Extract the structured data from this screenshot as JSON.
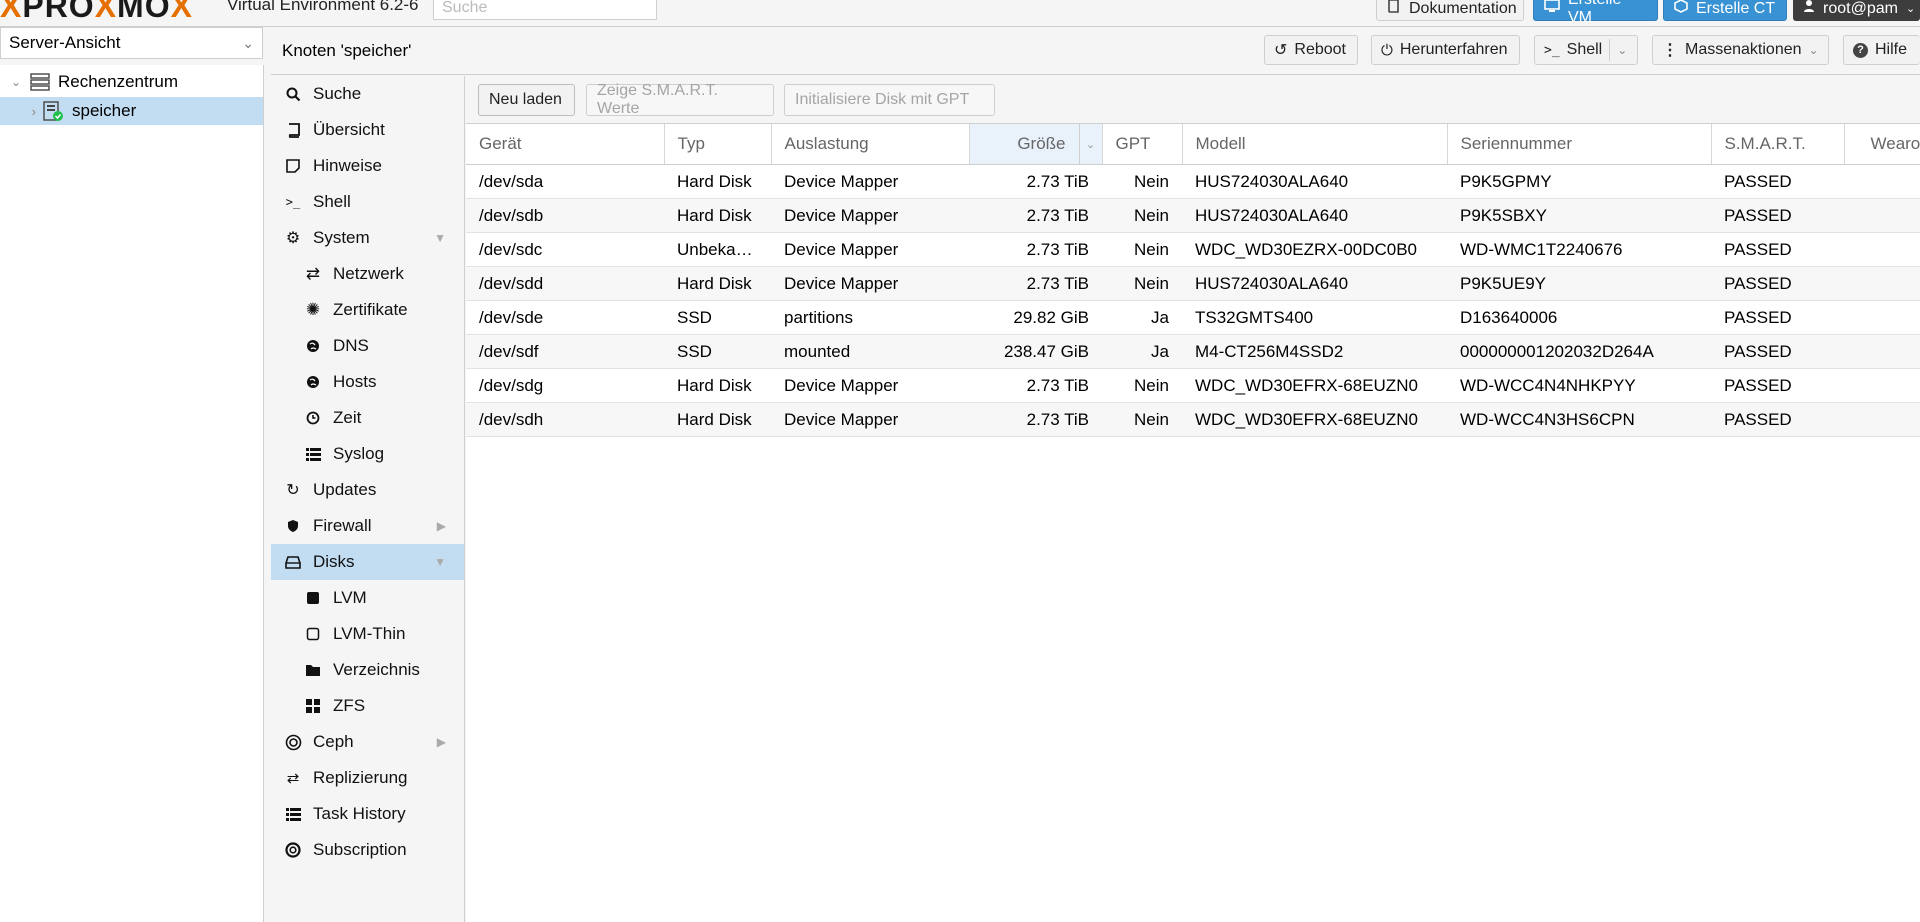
{
  "topbar": {
    "logo_x": "X",
    "logo_text_a": "PRO",
    "logo_mid": "X",
    "logo_text_b": "MO",
    "logo_end": "X",
    "version": "Virtual Environment 6.2-6",
    "search_placeholder": "Suche",
    "doc_button": "Dokumentation",
    "create_vm_button": "Erstelle VM",
    "create_ct_button": "Erstelle CT",
    "user_button": "root@pam"
  },
  "view_selector": {
    "value": "Server-Ansicht"
  },
  "tree": {
    "datacenter": "Rechenzentrum",
    "node": "speicher"
  },
  "node_header": {
    "title": "Knoten 'speicher'",
    "reboot": "Reboot",
    "shutdown": "Herunterfahren",
    "shell": "Shell",
    "bulk": "Massenaktionen",
    "help": "Hilfe"
  },
  "menu": {
    "items": [
      {
        "label": "Suche",
        "icon": "search-icon"
      },
      {
        "label": "Übersicht",
        "icon": "book-icon"
      },
      {
        "label": "Hinweise",
        "icon": "note-icon"
      },
      {
        "label": "Shell",
        "icon": "terminal-icon"
      },
      {
        "label": "System",
        "icon": "gears-icon"
      },
      {
        "label": "Netzwerk",
        "icon": "exchange-icon"
      },
      {
        "label": "Zertifikate",
        "icon": "certificate-icon"
      },
      {
        "label": "DNS",
        "icon": "globe-icon"
      },
      {
        "label": "Hosts",
        "icon": "globe-icon"
      },
      {
        "label": "Zeit",
        "icon": "clock-icon"
      },
      {
        "label": "Syslog",
        "icon": "list-icon"
      },
      {
        "label": "Updates",
        "icon": "refresh-icon"
      },
      {
        "label": "Firewall",
        "icon": "shield-icon"
      },
      {
        "label": "Disks",
        "icon": "hdd-icon"
      },
      {
        "label": "LVM",
        "icon": "square-icon"
      },
      {
        "label": "LVM-Thin",
        "icon": "square-outline-icon"
      },
      {
        "label": "Verzeichnis",
        "icon": "folder-icon"
      },
      {
        "label": "ZFS",
        "icon": "th-large-icon"
      },
      {
        "label": "Ceph",
        "icon": "ceph-icon"
      },
      {
        "label": "Replizierung",
        "icon": "retweet-icon"
      },
      {
        "label": "Task History",
        "icon": "list-icon"
      },
      {
        "label": "Subscription",
        "icon": "support-icon"
      }
    ]
  },
  "toolbar": {
    "reload": "Neu laden",
    "show_smart": "Zeige S.M.A.R.T. Werte",
    "init_gpt": "Initialisiere Disk mit GPT"
  },
  "grid": {
    "columns": [
      "Gerät",
      "Typ",
      "Auslastung",
      "Größe",
      "GPT",
      "Modell",
      "Seriennummer",
      "S.M.A.R.T.",
      "Wearout"
    ],
    "rows": [
      [
        "/dev/sda",
        "Hard Disk",
        "Device Mapper",
        "2.73 TiB",
        "Nein",
        "HUS724030ALA640",
        "P9K5GPMY",
        "PASSED",
        ""
      ],
      [
        "/dev/sdb",
        "Hard Disk",
        "Device Mapper",
        "2.73 TiB",
        "Nein",
        "HUS724030ALA640",
        "P9K5SBXY",
        "PASSED",
        ""
      ],
      [
        "/dev/sdc",
        "Unbeka…",
        "Device Mapper",
        "2.73 TiB",
        "Nein",
        "WDC_WD30EZRX-00DC0B0",
        "WD-WMC1T2240676",
        "PASSED",
        ""
      ],
      [
        "/dev/sdd",
        "Hard Disk",
        "Device Mapper",
        "2.73 TiB",
        "Nein",
        "HUS724030ALA640",
        "P9K5UE9Y",
        "PASSED",
        ""
      ],
      [
        "/dev/sde",
        "SSD",
        "partitions",
        "29.82 GiB",
        "Ja",
        "TS32GMTS400",
        "D163640006",
        "PASSED",
        ""
      ],
      [
        "/dev/sdf",
        "SSD",
        "mounted",
        "238.47 GiB",
        "Ja",
        "M4-CT256M4SSD2",
        "000000001202032D264A",
        "PASSED",
        ""
      ],
      [
        "/dev/sdg",
        "Hard Disk",
        "Device Mapper",
        "2.73 TiB",
        "Nein",
        "WDC_WD30EFRX-68EUZN0",
        "WD-WCC4N4NHKPYY",
        "PASSED",
        ""
      ],
      [
        "/dev/sdh",
        "Hard Disk",
        "Device Mapper",
        "2.73 TiB",
        "Nein",
        "WDC_WD30EFRX-68EUZN0",
        "WD-WCC4N3HS6CPN",
        "PASSED",
        ""
      ]
    ]
  },
  "colors": {
    "accent": "#3892d4",
    "selection": "#c2ddf2",
    "brand_orange": "#e57000"
  }
}
